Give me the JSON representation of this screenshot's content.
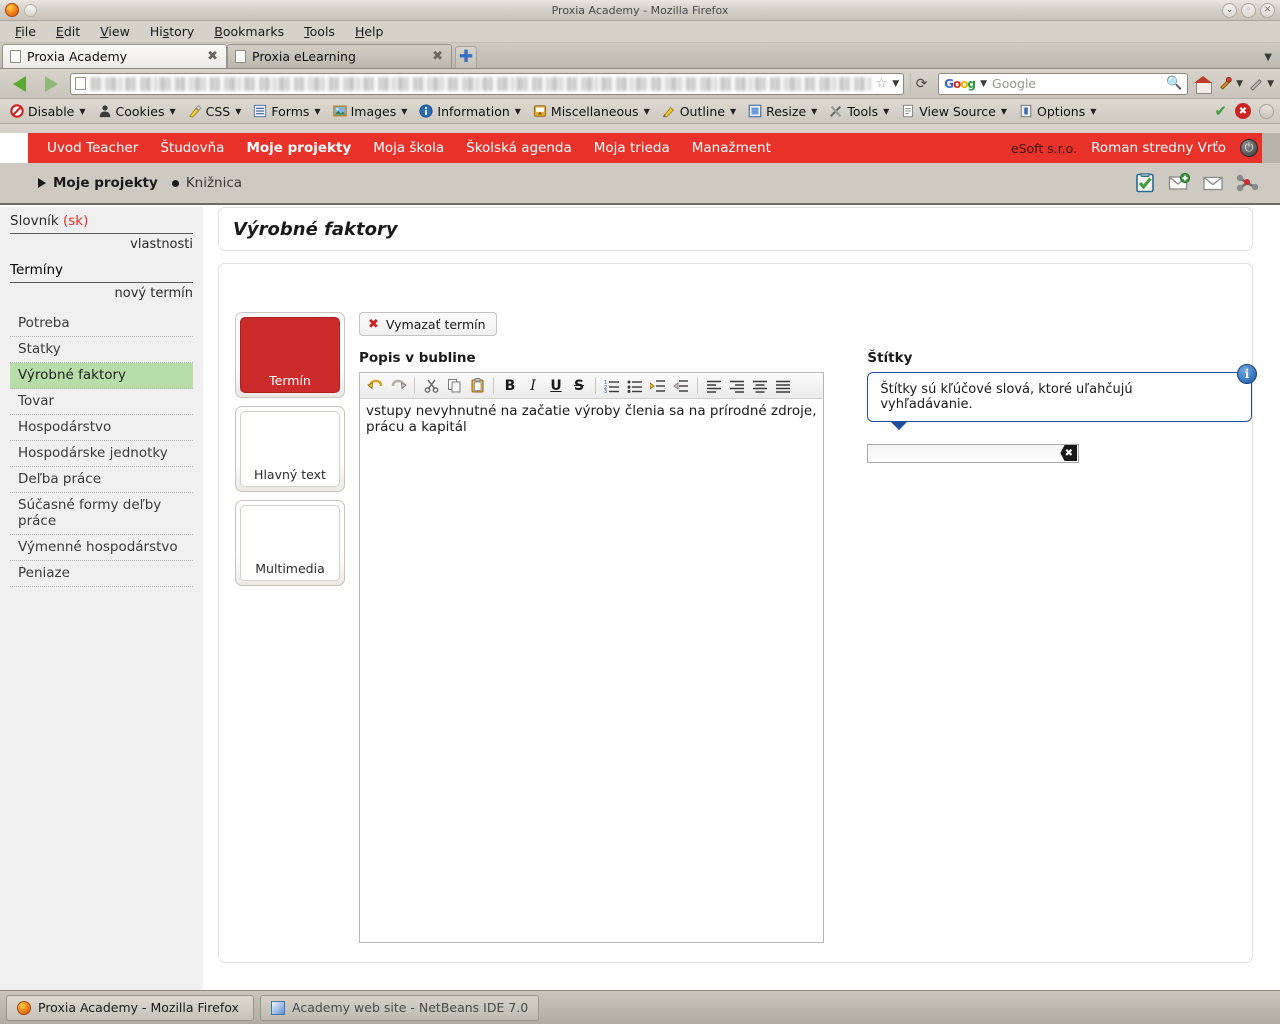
{
  "window": {
    "title": "Proxia Academy - Mozilla Firefox",
    "minimize": "⌄",
    "maximize": "◦",
    "close": "✕"
  },
  "menubar": [
    {
      "label": "File",
      "accel": "F"
    },
    {
      "label": "Edit",
      "accel": "E"
    },
    {
      "label": "View",
      "accel": "V"
    },
    {
      "label": "History",
      "accel": "s"
    },
    {
      "label": "Bookmarks",
      "accel": "B"
    },
    {
      "label": "Tools",
      "accel": "T"
    },
    {
      "label": "Help",
      "accel": "H"
    }
  ],
  "tabs": [
    {
      "label": "Proxia Academy",
      "close": "✖",
      "active": true
    },
    {
      "label": "Proxia eLearning",
      "close": "✖",
      "active": false
    }
  ],
  "newtab_label": "✚",
  "tablist_caret": "▼",
  "navbar": {
    "back_icon": "back-arrow-icon",
    "forward_icon": "forward-arrow-icon",
    "url_value": "",
    "star_icon": "☆",
    "url_caret": "▼",
    "reload_icon": "⟳",
    "search_placeholder": "Google",
    "search_value": "",
    "search_caret": "▼",
    "magnifier": "🔍",
    "home_icon": "home-icon"
  },
  "devbar": {
    "items": [
      {
        "label": "Disable",
        "icon": "disable-icon",
        "caret": "▼"
      },
      {
        "label": "Cookies",
        "icon": "cookies-icon",
        "caret": "▼"
      },
      {
        "label": "CSS",
        "icon": "css-icon",
        "caret": "▼"
      },
      {
        "label": "Forms",
        "icon": "forms-icon",
        "caret": "▼"
      },
      {
        "label": "Images",
        "icon": "images-icon",
        "caret": "▼"
      },
      {
        "label": "Information",
        "icon": "information-icon",
        "caret": "▼"
      },
      {
        "label": "Miscellaneous",
        "icon": "miscellaneous-icon",
        "caret": "▼"
      },
      {
        "label": "Outline",
        "icon": "outline-icon",
        "caret": "▼"
      },
      {
        "label": "Resize",
        "icon": "resize-icon",
        "caret": "▼"
      },
      {
        "label": "Tools",
        "icon": "tools-icon",
        "caret": "▼"
      },
      {
        "label": "View Source",
        "icon": "view-source-icon",
        "caret": "▼"
      },
      {
        "label": "Options",
        "icon": "options-icon",
        "caret": "▼"
      }
    ],
    "status": {
      "check": "✔",
      "error": "✖"
    }
  },
  "topnav": {
    "links": [
      {
        "label": "Uvod Teacher",
        "active": false
      },
      {
        "label": "Študovňa",
        "active": false
      },
      {
        "label": "Moje projekty",
        "active": true
      },
      {
        "label": "Moja škola",
        "active": false
      },
      {
        "label": "Školská agenda",
        "active": false
      },
      {
        "label": "Moja trieda",
        "active": false
      },
      {
        "label": "Manažment",
        "active": false
      }
    ],
    "company": "eSoft s.r.o.",
    "user": "Roman stredny Vrťo",
    "logout_icon": "power-icon"
  },
  "breadcrumb": {
    "items": [
      {
        "label": "Moje projekty",
        "marker": "triangle"
      },
      {
        "label": "Knižnica",
        "marker": "bullet"
      }
    ],
    "icons": [
      "clipboard-check-icon",
      "mail-add-icon",
      "envelope-icon",
      "molecule-icon"
    ]
  },
  "sidebar": {
    "dictionary_label": "Slovník",
    "dictionary_lang": "(sk)",
    "properties_link": "vlastnosti",
    "terms_label": "Termíny",
    "new_term_link": "nový termín",
    "terms": [
      {
        "label": "Potreba",
        "selected": false
      },
      {
        "label": "Statky",
        "selected": false
      },
      {
        "label": "Výrobné faktory",
        "selected": true
      },
      {
        "label": "Tovar",
        "selected": false
      },
      {
        "label": "Hospodárstvo",
        "selected": false
      },
      {
        "label": "Hospodárske jednotky",
        "selected": false
      },
      {
        "label": "Deľba práce",
        "selected": false
      },
      {
        "label": "Súčasné formy deľby práce",
        "selected": false
      },
      {
        "label": "Výmenné hospodárstvo",
        "selected": false
      },
      {
        "label": "Peniaze",
        "selected": false
      }
    ]
  },
  "main": {
    "page_title": "Výrobné faktory",
    "thumbs": [
      {
        "label": "Termín",
        "active": true
      },
      {
        "label": "Hlavný text",
        "active": false
      },
      {
        "label": "Multimedia",
        "active": false
      }
    ],
    "delete_button": "Vymazať termín",
    "delete_icon": "✖",
    "bubble_label": "Popis v bubline",
    "rte_toolbar": [
      {
        "name": "undo-icon",
        "glyph": "↺"
      },
      {
        "name": "redo-icon",
        "glyph": "↻"
      },
      {
        "name": "sep",
        "glyph": ""
      },
      {
        "name": "cut-icon",
        "glyph": "✂"
      },
      {
        "name": "copy-icon",
        "glyph": "⧉"
      },
      {
        "name": "paste-icon",
        "glyph": "📋"
      },
      {
        "name": "sep",
        "glyph": ""
      },
      {
        "name": "bold-icon",
        "glyph": "B"
      },
      {
        "name": "italic-icon",
        "glyph": "I"
      },
      {
        "name": "underline-icon",
        "glyph": "U"
      },
      {
        "name": "strikethrough-icon",
        "glyph": "S"
      },
      {
        "name": "sep",
        "glyph": ""
      },
      {
        "name": "numbered-list-icon",
        "glyph": "☰"
      },
      {
        "name": "bullet-list-icon",
        "glyph": "☰"
      },
      {
        "name": "indent-icon",
        "glyph": "⇥"
      },
      {
        "name": "outdent-icon",
        "glyph": "⇤"
      },
      {
        "name": "sep",
        "glyph": ""
      },
      {
        "name": "align-left-icon",
        "glyph": "≡"
      },
      {
        "name": "align-right-icon",
        "glyph": "≡"
      },
      {
        "name": "align-center-icon",
        "glyph": "≡"
      },
      {
        "name": "justify-icon",
        "glyph": "≡"
      }
    ],
    "rte_text": "vstupy nevyhnutné na začatie výroby členia sa na prírodné zdroje, prácu a kapitál",
    "tags_label": "Štítky",
    "tags_tooltip": "Štítky sú kľúčové slová, ktoré uľahčujú vyhľadávanie.",
    "tags_tooltip_icon": "i",
    "tags_input_value": "",
    "tags_clear_icon": "✖"
  },
  "taskbar": [
    {
      "label": "Proxia Academy - Mozilla Firefox",
      "icon": "firefox-icon"
    },
    {
      "label": "Academy web site - NetBeans IDE 7.0",
      "icon": "netbeans-icon"
    }
  ],
  "colors": {
    "accent_red": "#e8322a",
    "thumb_red": "#cc2b2b",
    "selected_green": "#b7dda8",
    "tooltip_blue": "#1f4e9c",
    "lang_red": "#e03028"
  }
}
